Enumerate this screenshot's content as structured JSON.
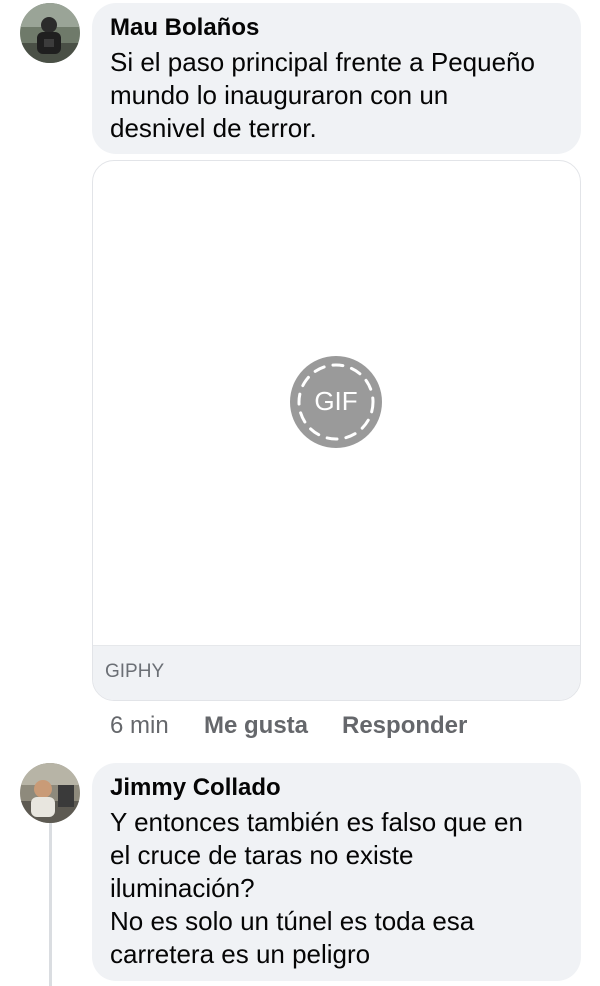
{
  "comments": [
    {
      "author": "Mau Bolaños",
      "text": "Si el paso principal frente a Pequeño\nmundo lo inauguraron con un\ndesnivel de terror.",
      "attachment": {
        "type": "gif",
        "badge_label": "GIF",
        "source": "GIPHY"
      },
      "actions": {
        "time": "6 min",
        "like": "Me gusta",
        "reply": "Responder"
      }
    },
    {
      "author": "Jimmy Collado",
      "text": "Y entonces también es falso que en\nel cruce de taras no existe\niluminación?\nNo es solo un túnel es toda esa\ncarretera es un peligro"
    }
  ],
  "colors": {
    "bubble_bg": "#f0f2f5",
    "secondary_text": "#65676b",
    "gif_badge": "#9a9a9a"
  }
}
